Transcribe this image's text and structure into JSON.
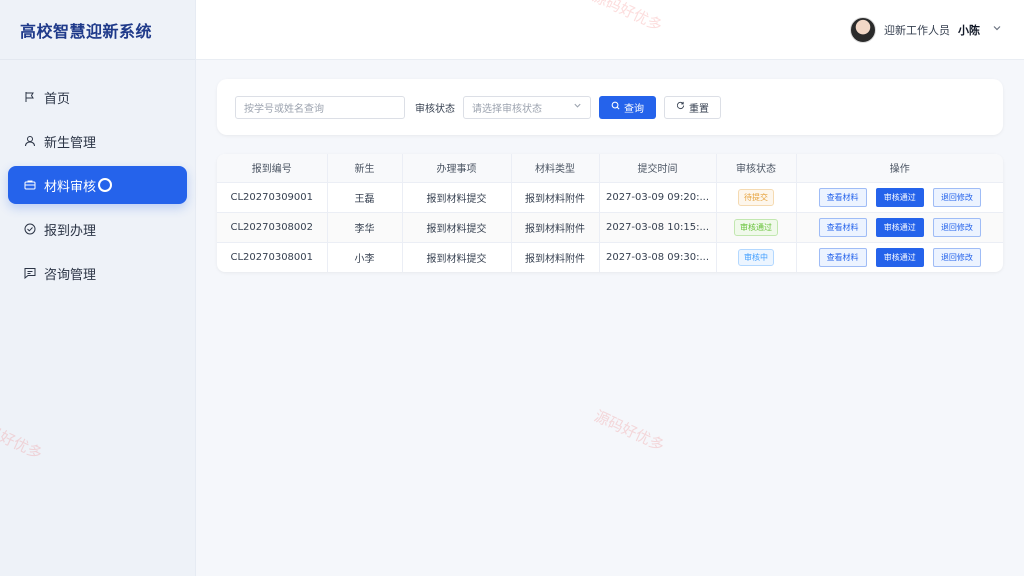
{
  "app": {
    "title": "高校智慧迎新系统"
  },
  "sidebar": {
    "items": [
      {
        "label": "首页",
        "icon": "flag-icon"
      },
      {
        "label": "新生管理",
        "icon": "user-icon"
      },
      {
        "label": "材料审核",
        "icon": "briefcase-icon"
      },
      {
        "label": "报到办理",
        "icon": "check-circle-icon"
      },
      {
        "label": "咨询管理",
        "icon": "message-icon"
      }
    ]
  },
  "header": {
    "role": "迎新工作人员",
    "user": "小陈"
  },
  "search": {
    "placeholder": "按学号或姓名查询",
    "status_label": "审核状态",
    "status_placeholder": "请选择审核状态",
    "query_label": "查询",
    "reset_label": "重置"
  },
  "table": {
    "headers": [
      "报到编号",
      "新生",
      "办理事项",
      "材料类型",
      "提交时间",
      "审核状态",
      "操作"
    ],
    "rows": [
      {
        "id": "CL20270309001",
        "name": "王磊",
        "item": "报到材料提交",
        "type": "报到材料附件",
        "time": "2027-03-09 09:20:...",
        "status": "待提交"
      },
      {
        "id": "CL20270308002",
        "name": "李华",
        "item": "报到材料提交",
        "type": "报到材料附件",
        "time": "2027-03-08 10:15:...",
        "status": "审核通过"
      },
      {
        "id": "CL20270308001",
        "name": "小李",
        "item": "报到材料提交",
        "type": "报到材料附件",
        "time": "2027-03-08 09:30:...",
        "status": "审核中"
      }
    ],
    "actions": {
      "view": "查看材料",
      "approve": "审核通过",
      "return": "退回修改"
    }
  },
  "watermark": "源码好优多"
}
